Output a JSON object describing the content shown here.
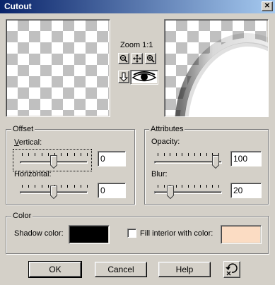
{
  "window": {
    "title": "Cutout",
    "close_glyph": "✕"
  },
  "zoom": {
    "label": "Zoom 1:1",
    "zoom_out_icon": "zoom-out-icon",
    "pan_icon": "pan-icon",
    "zoom_in_icon": "zoom-in-icon"
  },
  "offset": {
    "group_label": "Offset",
    "vertical_label": "Vertical:",
    "vertical_value": "0",
    "vertical_level": 0.5,
    "horizontal_label": "Horizontal:",
    "horizontal_value": "0",
    "horizontal_level": 0.5
  },
  "attributes": {
    "group_label": "Attributes",
    "opacity_label": "Opacity:",
    "opacity_value": "100",
    "opacity_level": 1.0,
    "blur_label": "Blur:",
    "blur_value": "20",
    "blur_level": 0.2
  },
  "color": {
    "group_label": "Color",
    "shadow_label": "Shadow color:",
    "shadow_color": "#000000",
    "fill_label": "Fill interior with color:",
    "fill_checked": false,
    "fill_color": "#fbdcc3"
  },
  "buttons": {
    "ok": "OK",
    "cancel": "Cancel",
    "help": "Help"
  }
}
